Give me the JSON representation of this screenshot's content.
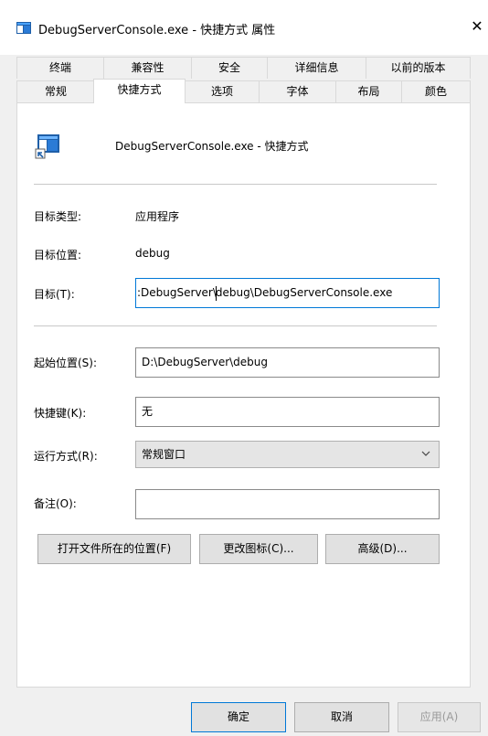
{
  "window": {
    "title": "DebugServerConsole.exe - 快捷方式 属性",
    "close_glyph": "✕"
  },
  "tabs": {
    "row1": [
      "终端",
      "兼容性",
      "安全",
      "详细信息",
      "以前的版本"
    ],
    "row2": [
      "常规",
      "快捷方式",
      "选项",
      "字体",
      "布局",
      "颜色"
    ],
    "active": "快捷方式"
  },
  "shortcut": {
    "header_title": "DebugServerConsole.exe - 快捷方式",
    "target_type_label": "目标类型:",
    "target_type_value": "应用程序",
    "target_location_label": "目标位置:",
    "target_location_value": "debug",
    "target_label": "目标(T):",
    "target_value_before_caret": ":DebugServer\\",
    "target_value_after_caret": "debug\\DebugServerConsole.exe",
    "start_in_label": "起始位置(S):",
    "start_in_value": "D:\\DebugServer\\debug",
    "hotkey_label": "快捷键(K):",
    "hotkey_value": "无",
    "run_label": "运行方式(R):",
    "run_value": "常规窗口",
    "comment_label": "备注(O):",
    "comment_value": "",
    "open_location_button": "打开文件所在的位置(F)",
    "change_icon_button": "更改图标(C)...",
    "advanced_button": "高级(D)..."
  },
  "footer": {
    "ok": "确定",
    "cancel": "取消",
    "apply": "应用(A)"
  },
  "colors": {
    "focus_border": "#0078d7",
    "panel_bg": "#ffffff",
    "dialog_bg": "#f0f0f0"
  }
}
